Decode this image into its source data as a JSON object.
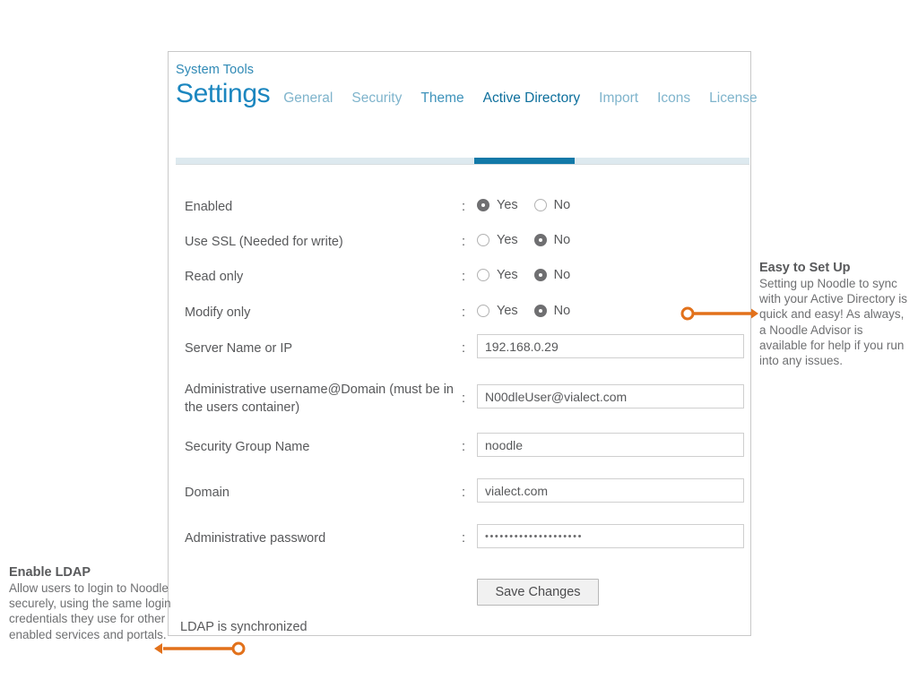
{
  "panel": {
    "breadcrumb": "System Tools",
    "title": "Settings",
    "tabs": [
      {
        "label": "General",
        "state": "inactive"
      },
      {
        "label": "Security",
        "state": "inactive"
      },
      {
        "label": "Theme",
        "state": "mid"
      },
      {
        "label": "Active Directory",
        "state": "active"
      },
      {
        "label": "Import",
        "state": "inactive"
      },
      {
        "label": "Icons",
        "state": "inactive"
      },
      {
        "label": "License",
        "state": "inactive"
      }
    ],
    "colon": ":",
    "status": "LDAP is synchronized",
    "save_label": "Save Changes"
  },
  "form": {
    "radio_rows": [
      {
        "label": "Enabled",
        "yes": "Yes",
        "no": "No",
        "selected": "yes"
      },
      {
        "label": "Use SSL (Needed for write)",
        "yes": "Yes",
        "no": "No",
        "selected": "no"
      },
      {
        "label": "Read only",
        "yes": "Yes",
        "no": "No",
        "selected": "no"
      },
      {
        "label": "Modify only",
        "yes": "Yes",
        "no": "No",
        "selected": "no"
      }
    ],
    "text_rows": [
      {
        "label": "Server Name or IP",
        "value": "192.168.0.29",
        "placeholder": ""
      },
      {
        "label": "Administrative username@Domain (must be in the users container)",
        "value": "N00dleUser@vialect.com",
        "placeholder": ""
      },
      {
        "label": "Security Group Name",
        "value": "noodle",
        "placeholder": ""
      },
      {
        "label": "Domain",
        "value": "vialect.com",
        "placeholder": ""
      },
      {
        "label": "Administrative password",
        "value": "••••••••••••••••••••",
        "placeholder": ""
      }
    ]
  },
  "annotations": {
    "right": {
      "title": "Easy to Set Up",
      "body": "Setting up Noodle to sync with your Active Directory is quick and easy! As always, a Noodle Advisor is available for help if you run into any issues."
    },
    "left": {
      "title": "Enable LDAP",
      "body": "Allow users to login to Noodle securely, using the same login credentials they use for other enabled services and portals."
    }
  },
  "colors": {
    "accent_blue": "#1b86bf",
    "tab_active": "#0d6f9c",
    "tab_inactive": "#7fb4cc",
    "band": "#dde9ef",
    "callout_orange": "#e2711b",
    "text_gray": "#58595b"
  }
}
